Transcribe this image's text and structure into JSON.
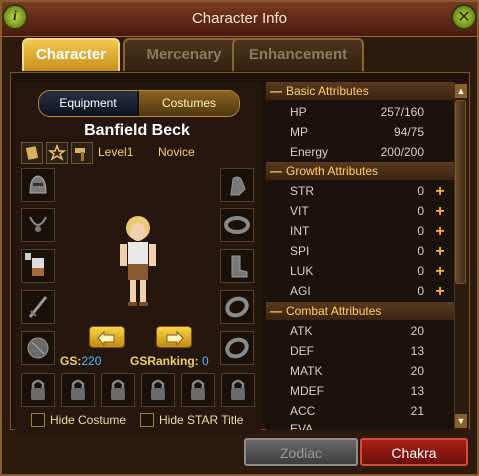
{
  "window": {
    "title": "Character Info",
    "info_glyph": "i",
    "close_glyph": "✕"
  },
  "tabs": [
    {
      "label": "Character",
      "active": true
    },
    {
      "label": "Mercenary",
      "active": false
    },
    {
      "label": "Enhancement",
      "active": false
    }
  ],
  "switch": {
    "equipment": "Equipment",
    "costumes": "Costumes",
    "selected": "Costumes"
  },
  "character": {
    "name": "Banfield Beck",
    "level": "Level1",
    "rank": "Novice"
  },
  "gs": {
    "label": "GS:",
    "value": "220",
    "ranking_label": "GSRanking:",
    "ranking_value": "0"
  },
  "options": {
    "hide_costume": "Hide Costume",
    "hide_star_title": "Hide STAR Title"
  },
  "attributes": {
    "basic_title": "Basic Attributes",
    "basic": [
      {
        "name": "HP",
        "value": "257/160"
      },
      {
        "name": "MP",
        "value": "94/75"
      },
      {
        "name": "Energy",
        "value": "200/200"
      }
    ],
    "growth_title": "Growth Attributes",
    "growth": [
      {
        "name": "STR",
        "value": "0"
      },
      {
        "name": "VIT",
        "value": "0"
      },
      {
        "name": "INT",
        "value": "0"
      },
      {
        "name": "SPI",
        "value": "0"
      },
      {
        "name": "LUK",
        "value": "0"
      },
      {
        "name": "AGI",
        "value": "0"
      }
    ],
    "combat_title": "Combat Attributes",
    "combat": [
      {
        "name": "ATK",
        "value": "20"
      },
      {
        "name": "DEF",
        "value": "13"
      },
      {
        "name": "MATK",
        "value": "20"
      },
      {
        "name": "MDEF",
        "value": "13"
      },
      {
        "name": "ACC",
        "value": "21"
      },
      {
        "name": "EVA",
        "value": ""
      }
    ],
    "collapse_glyph": "—",
    "plus_glyph": "+"
  },
  "buttons": {
    "zodiac": "Zodiac",
    "chakra": "Chakra"
  },
  "colors": {
    "accent_gold": "#f0c850",
    "gs_value": "#4fb8ff",
    "chakra": "#a8201a"
  }
}
